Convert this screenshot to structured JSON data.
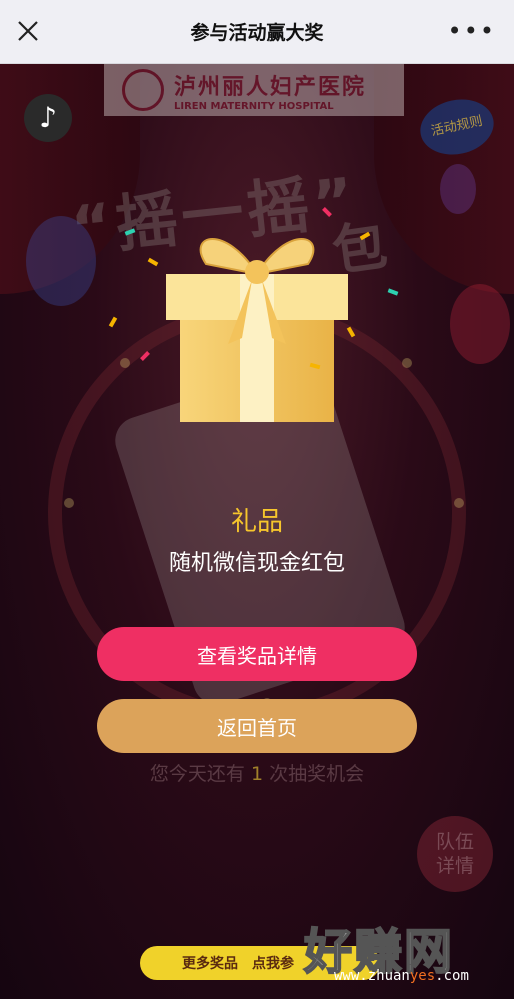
{
  "nav": {
    "title": "参与活动赢大奖",
    "close_icon": "close-icon",
    "more_label": "•••"
  },
  "header": {
    "logo_cn": "泸州丽人妇产医院",
    "logo_en": "LIREN MATERNITY HOSPITAL",
    "music_icon": "♪",
    "rules_badge": "活动规则"
  },
  "background": {
    "shake_title": "“摇一摇”",
    "shake_suffix": "包"
  },
  "prize": {
    "heading": "礼品",
    "name": "随机微信现金红包"
  },
  "actions": {
    "view_prize_label": "查看奖品详情",
    "back_home_label": "返回首页"
  },
  "chances": {
    "prefix": "您今天还有",
    "count": "1",
    "suffix": "次抽奖机会"
  },
  "team": {
    "line1": "队伍",
    "line2": "详情"
  },
  "footer": {
    "more_prizes_label": "更多奖品　点我参"
  },
  "watermark": {
    "big": "好赚网",
    "small_prefix": "www.zhuan",
    "small_highlight": "yes",
    "small_suffix": ".com"
  },
  "colors": {
    "primary_button": "#ef2f63",
    "secondary_button": "#dca35a",
    "prize_heading": "#f7c62c",
    "background": "#2a0a17"
  }
}
